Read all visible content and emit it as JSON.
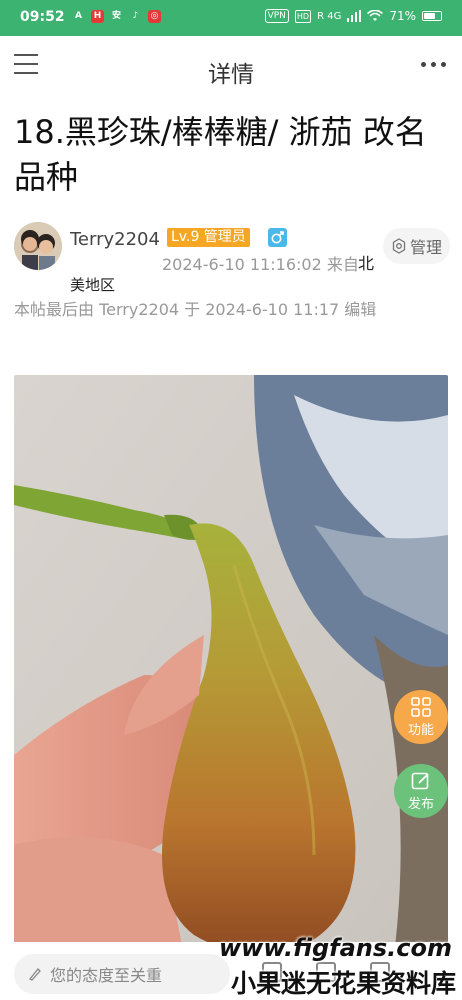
{
  "status_bar": {
    "time": "09:52",
    "app_icons": [
      {
        "name": "a-icon",
        "label": "A",
        "color": "#3cb371"
      },
      {
        "name": "hbo-app-icon",
        "label": "H",
        "color": "#e53935"
      },
      {
        "name": "chat-app-icon",
        "label": "安",
        "color": "#3cb371"
      },
      {
        "name": "tiktok-icon",
        "label": "♪",
        "color": "#3cb371"
      },
      {
        "name": "news-app-icon",
        "label": "◎",
        "color": "#e53935"
      }
    ],
    "vpn": "VPN",
    "hd": "HD",
    "network": "R 4G",
    "battery": "71%",
    "battery_level": 0.71
  },
  "header": {
    "title": "详情"
  },
  "post": {
    "title": "18.黑珍珠/棒棒糖/ 浙茄 改名品种",
    "author": "Terry2204",
    "level": "Lv.9 管理员",
    "manage_label": "管理",
    "time": "2024-6-10 11:16:02 来自",
    "location_part1": "北",
    "location_part2": "美地区",
    "edit_note": "本帖最后由 Terry2204 于 2024-6-10 11:17 编辑"
  },
  "fab": {
    "function_label": "功能",
    "publish_label": "发布"
  },
  "bottom_bar": {
    "comment_placeholder": "您的态度至关重"
  },
  "watermark": {
    "url": "www.figfans.com",
    "name": "小果迷无花果资料库"
  },
  "colors": {
    "accent": "#3cb371",
    "level_badge": "#f5a623",
    "fab_function": "#f7a84a",
    "fab_publish": "#6cc27a"
  }
}
